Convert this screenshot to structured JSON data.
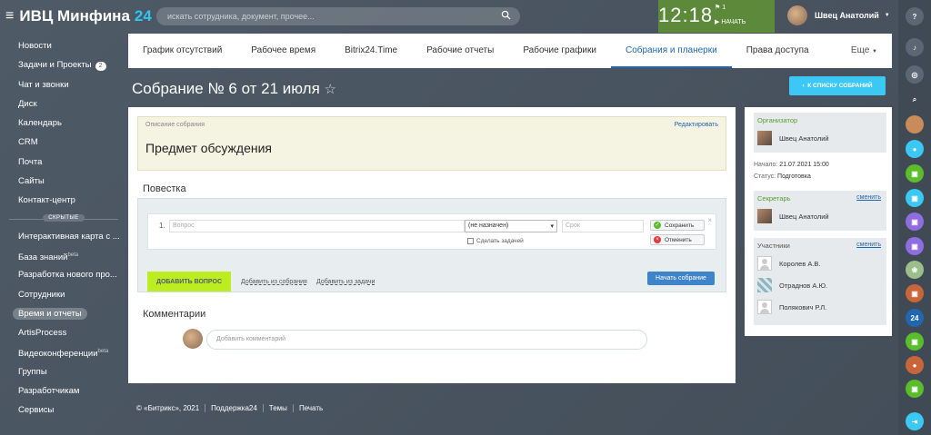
{
  "header": {
    "logo_title": "ИВЦ Минфина",
    "logo_num": "24",
    "search_placeholder": "искать сотрудника, документ, прочее...",
    "clock_time": "12:18",
    "clock_flag": "1",
    "clock_start": "НАЧАТЬ",
    "user_name": "Швец Анатолий"
  },
  "sidebar": {
    "items_top": [
      {
        "label": "Новости"
      },
      {
        "label": "Задачи и Проекты",
        "badge": "2"
      },
      {
        "label": "Чат и звонки"
      },
      {
        "label": "Диск"
      },
      {
        "label": "Календарь"
      },
      {
        "label": "CRM"
      },
      {
        "label": "Почта"
      },
      {
        "label": "Сайты"
      },
      {
        "label": "Контакт-центр"
      }
    ],
    "hidden_label": "СКРЫТЫЕ",
    "items_hidden": [
      {
        "label": "Интерактивная карта с ..."
      },
      {
        "label": "База знаний",
        "sup": "beta"
      },
      {
        "label": "Разработка нового про..."
      },
      {
        "label": "Сотрудники"
      },
      {
        "label": "Время и отчеты",
        "active": true
      },
      {
        "label": "ArtisProcess"
      },
      {
        "label": "Видеоконференции",
        "sup": "beta"
      },
      {
        "label": "Группы"
      },
      {
        "label": "Разработчикам"
      },
      {
        "label": "Сервисы"
      }
    ]
  },
  "tabs": [
    {
      "label": "График отсутствий"
    },
    {
      "label": "Рабочее время"
    },
    {
      "label": "Bitrix24.Time"
    },
    {
      "label": "Рабочие отчеты"
    },
    {
      "label": "Рабочие графики"
    },
    {
      "label": "Собрания и планерки",
      "active": true
    },
    {
      "label": "Права доступа"
    }
  ],
  "tabs_more": "Еще",
  "page": {
    "title": "Собрание № 6 от 21 июля",
    "back_button": "К СПИСКУ СОБРАНИЙ"
  },
  "meeting": {
    "desc_label": "Описание собрания",
    "edit_link": "Редактировать",
    "subject": "Предмет обсуждения",
    "agenda_title": "Повестка",
    "row_number": "1.",
    "question_placeholder": "Вопрос",
    "assignee_select": "(не назначен)",
    "deadline_placeholder": "Срок",
    "make_task": "Сделать задачей",
    "save": "Сохранить",
    "cancel": "Отменить",
    "add_question": "ДОБАВИТЬ ВОПРОС",
    "add_from_meeting": "Добавить из собрания",
    "add_from_task": "Добавить из задачи",
    "start_meeting": "Начать собрание",
    "comments_title": "Комментарии",
    "comment_placeholder": "Добавить комментарий"
  },
  "right_panel": {
    "organizer_label": "Организатор",
    "organizer_name": "Швец Анатолий",
    "start_label": "Начало:",
    "start_value": "21.07.2021 15:00",
    "status_label": "Статус:",
    "status_value": "Подготовка",
    "secretary_label": "Секретарь",
    "change": "сменить",
    "secretary_name": "Швец Анатолий",
    "participants_label": "Участники",
    "participants": [
      "Королев А.В.",
      "Отраднов А.Ю.",
      "Полякович Р.Л."
    ]
  },
  "footer": [
    "© «Битрикс», 2021",
    "Поддержка24",
    "Темы",
    "Печать"
  ],
  "rail": {
    "badge_24": "24"
  },
  "colors": {
    "accent": "#2067b0",
    "green": "#bbed21",
    "sky": "#3bc8f5"
  }
}
